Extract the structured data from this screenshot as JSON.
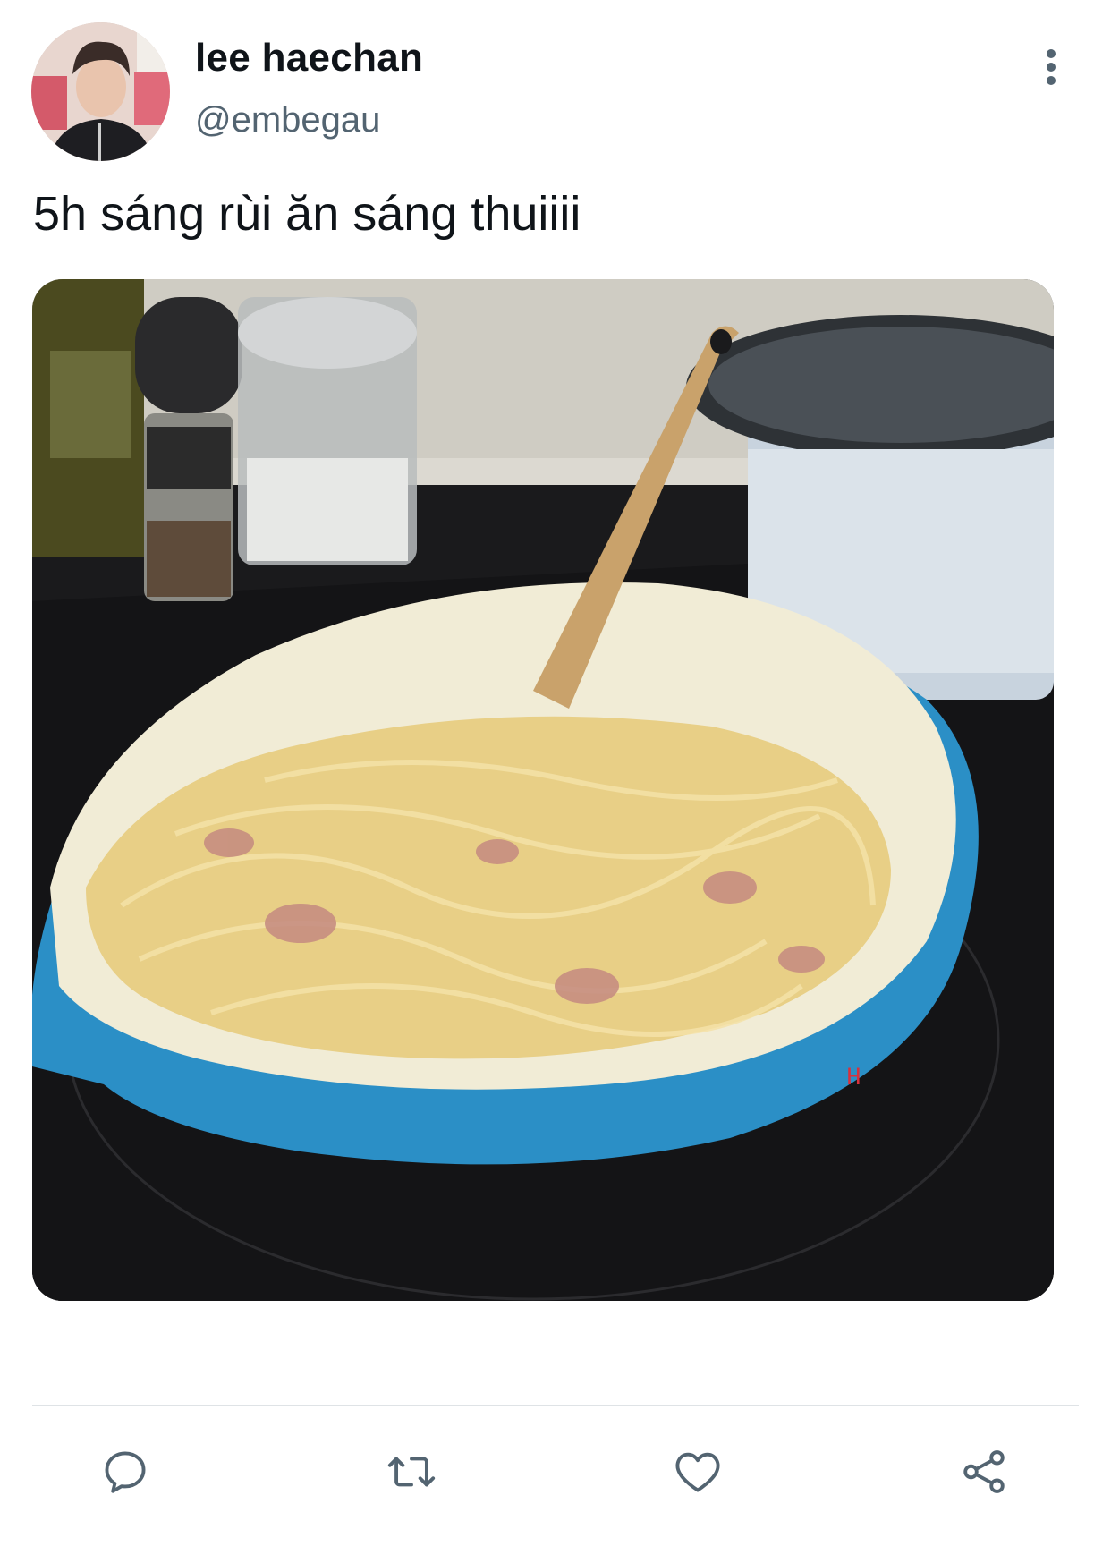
{
  "author": {
    "display_name": "lee haechan",
    "handle": "@embegau",
    "avatar_icon": "profile-photo"
  },
  "tweet": {
    "text": "5h sáng rùi ăn sáng thuiiii",
    "media_description_icon": "photo"
  },
  "actions": {
    "reply_icon": "reply-icon",
    "retweet_icon": "retweet-icon",
    "like_icon": "heart-icon",
    "share_icon": "share-icon"
  },
  "colors": {
    "primary_text": "#0f1419",
    "secondary_text": "#536471",
    "divider": "#dfe3e6"
  }
}
